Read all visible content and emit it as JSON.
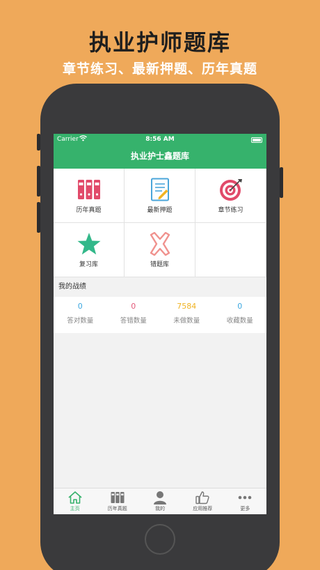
{
  "promo": {
    "title": "执业护师题库",
    "subtitle": "章节练习、最新押题、历年真题"
  },
  "status_bar": {
    "carrier": "Carrier",
    "time": "8:56 AM"
  },
  "app": {
    "title": "执业护士鑫题库"
  },
  "grid": {
    "items": [
      {
        "label": "历年真题",
        "icon": "binders-icon"
      },
      {
        "label": "最新押题",
        "icon": "document-icon"
      },
      {
        "label": "章节练习",
        "icon": "target-icon"
      },
      {
        "label": "复习库",
        "icon": "star-icon"
      },
      {
        "label": "错题库",
        "icon": "cross-icon"
      }
    ]
  },
  "stats": {
    "section_title": "我的战绩",
    "items": [
      {
        "value": "0",
        "label": "答对数量",
        "color": "#3BA7E0"
      },
      {
        "value": "0",
        "label": "答错数量",
        "color": "#E35A7A"
      },
      {
        "value": "7584",
        "label": "未做数量",
        "color": "#F0B323"
      },
      {
        "value": "0",
        "label": "收藏数量",
        "color": "#3BA7E0"
      }
    ]
  },
  "tabs": [
    {
      "label": "主页",
      "icon": "home-icon",
      "active": true
    },
    {
      "label": "历年真题",
      "icon": "binders-icon"
    },
    {
      "label": "我的",
      "icon": "user-icon"
    },
    {
      "label": "应用推荐",
      "icon": "thumbs-up-icon"
    },
    {
      "label": "更多",
      "icon": "more-icon"
    }
  ],
  "colors": {
    "background": "#EFA95A",
    "primary_green": "#36B26C",
    "icon_red": "#E14A6A",
    "icon_blue": "#4BA6DA",
    "icon_teal": "#33B88A",
    "icon_pink": "#F0928E"
  }
}
